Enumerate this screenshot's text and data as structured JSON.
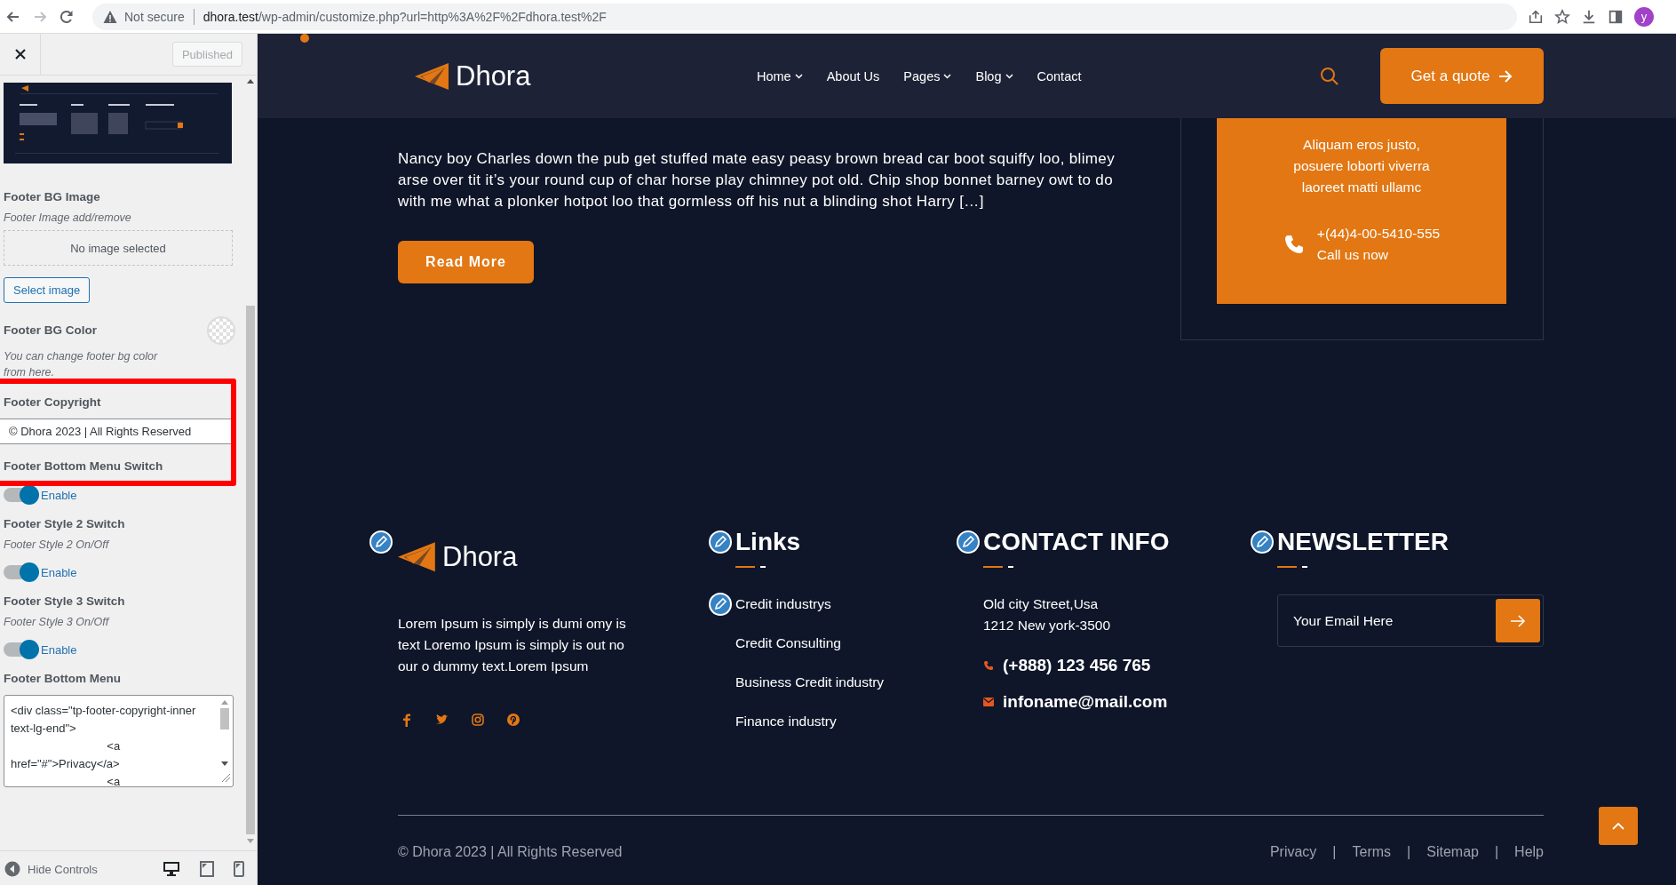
{
  "browser": {
    "security": "Not secure",
    "url_host": "dhora.test",
    "url_path": "/wp-admin/customize.php?url=http%3A%2F%2Fdhora.test%2F",
    "avatar": "y"
  },
  "customizer": {
    "publish_button": {
      "label": "Published",
      "disabled": true
    },
    "highlight_frame": true,
    "sections": [
      {
        "title": "Footer BG Image",
        "description": "Footer Image add/remove",
        "empty_text": "No image selected",
        "button": "Select image"
      },
      {
        "kind": "color",
        "title": "Footer BG Color",
        "description": "You can change footer bg color from here."
      },
      {
        "kind": "text",
        "title": "Footer Copyright",
        "value": "© Dhora 2023 | All Rights Reserved"
      },
      {
        "kind": "toggle",
        "title": "Footer Bottom Menu Switch",
        "toggle_label": "Enable",
        "on": true
      },
      {
        "kind": "toggle",
        "title": "Footer Style 2 Switch",
        "description": "Footer Style 2 On/Off",
        "toggle_label": "Enable",
        "on": true
      },
      {
        "kind": "toggle",
        "title": "Footer Style 3 Switch",
        "description": "Footer Style 3 On/Off",
        "toggle_label": "Enable",
        "on": true
      },
      {
        "kind": "textarea",
        "title": "Footer Bottom Menu",
        "value": "<div class=\"tp-footer-copyright-inner text-lg-end\">\n                              <a href=\"#\">Privacy</a>\n                              <a"
      }
    ],
    "hide_controls": "Hide Controls",
    "devices": [
      {
        "kind": "desktop",
        "selected": true
      },
      {
        "kind": "tablet",
        "selected": false
      },
      {
        "kind": "mobile",
        "selected": false
      }
    ]
  },
  "site": {
    "logo": "Dhora",
    "nav": [
      {
        "label": "Home",
        "dropdown": true
      },
      {
        "label": "About Us",
        "dropdown": false
      },
      {
        "label": "Pages",
        "dropdown": true
      },
      {
        "label": "Blog",
        "dropdown": true
      },
      {
        "label": "Contact",
        "dropdown": false
      }
    ],
    "quote_button": "Get a quote",
    "post": {
      "excerpt": "Nancy boy Charles down the pub get stuffed mate easy peasy brown bread car boot squiffy loo, blimey arse over tit it’s your round cup of char horse play chimney pot old. Chip shop bonnet barney owt to do with me what a plonker hotpot loo that gormless off his nut a blinding shot Harry […]",
      "button": "Read More"
    },
    "contact_card": {
      "text": "Aliquam eros justo, posuere loborti viverra laoreet matti ullamc",
      "phone": "+(44)4-00-5410-555",
      "phone_label": "Call us now"
    },
    "footer": {
      "brand": {
        "logo": "Dhora",
        "edit_shortcut": true,
        "about": "Lorem Ipsum is simply is dumi omy is text Loremo Ipsum is simply is out no our o dummy text.Lorem Ipsum",
        "social": [
          {
            "kind": "facebook"
          },
          {
            "kind": "twitter"
          },
          {
            "kind": "instagram"
          },
          {
            "kind": "pinterest"
          }
        ]
      },
      "links": {
        "title": "Links",
        "edit_shortcut": true,
        "items": [
          {
            "label": "Credit industrys",
            "edit_shortcut": true
          },
          {
            "label": "Credit Consulting",
            "edit_shortcut": false
          },
          {
            "label": "Business Credit industry",
            "edit_shortcut": false
          },
          {
            "label": "Finance industry",
            "edit_shortcut": false
          }
        ]
      },
      "contact": {
        "title": "CONTACT INFO",
        "edit_shortcut": true,
        "address": [
          "Old city Street,Usa",
          "1212 New york-3500"
        ],
        "phone": "(+888) 123 456 765",
        "email": "infoname@mail.com"
      },
      "newsletter": {
        "title": "NEWSLETTER",
        "edit_shortcut": true,
        "placeholder": "Your Email Here"
      },
      "copyright": "© Dhora 2023 | All Rights Reserved",
      "bottom_menu": [
        "Privacy",
        "Terms",
        "Sitemap",
        "Help"
      ],
      "bottom_menu_separator": "|"
    }
  }
}
